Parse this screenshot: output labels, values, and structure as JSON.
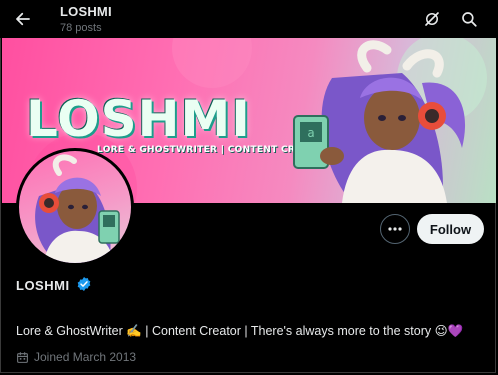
{
  "header": {
    "title": "LOSHMI",
    "post_count": "78 posts"
  },
  "banner": {
    "logo_text": "LOSHMI",
    "tagline": "LORE & GHOSTWRITER | CONTENT CREATOR"
  },
  "profile": {
    "display_name": "LOSHMI",
    "bio": "Lore & GhostWriter ✍️ | Content Creator | There's always more to the story 😉💜",
    "joined": "Joined March 2013"
  },
  "actions": {
    "follow_label": "Follow",
    "more_label": "•••"
  },
  "icons": {
    "back": "back-arrow-icon",
    "grok": "grok-icon",
    "search": "search-icon",
    "verified": "verified-badge-icon",
    "calendar": "calendar-icon",
    "more": "more-icon"
  },
  "colors": {
    "background": "#000000",
    "text_primary": "#e7e9ea",
    "text_secondary": "#71767b",
    "verified_blue": "#1d9bf0",
    "follow_bg": "#eff3f4",
    "banner_pink": "#ff5fa8",
    "logo_teal": "#1d9e8c"
  }
}
